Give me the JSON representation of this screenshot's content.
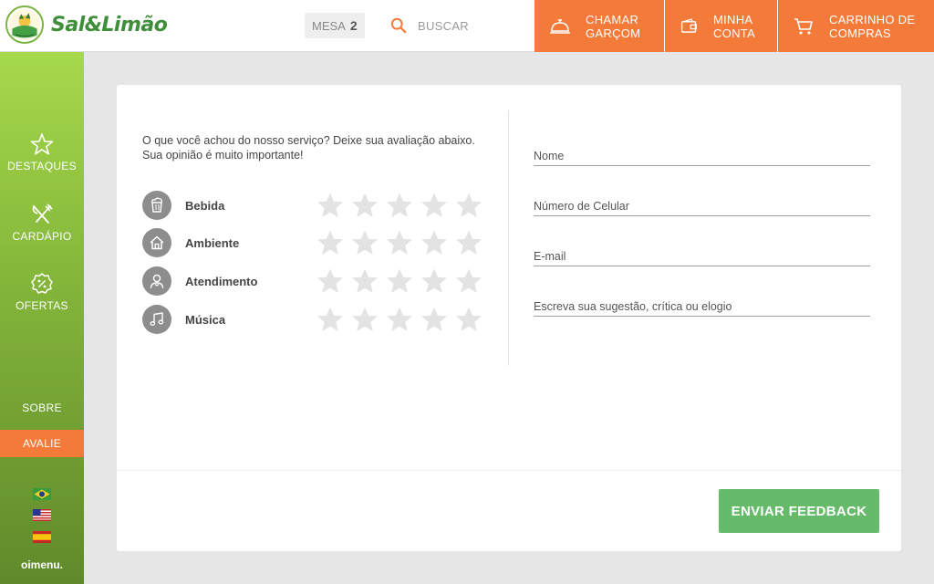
{
  "brand": {
    "name": "Sal&Limão",
    "logo_text": "CUIABANA"
  },
  "header": {
    "table_label": "MESA",
    "table_number": "2",
    "search_label": "BUSCAR",
    "call_waiter": [
      "CHAMAR",
      "GARÇOM"
    ],
    "my_account": [
      "MINHA",
      "CONTA"
    ],
    "cart": [
      "CARRINHO DE",
      "COMPRAS"
    ],
    "accent_color": "#f47a3a"
  },
  "sidebar": {
    "items": [
      {
        "label": "DESTAQUES",
        "icon": "star-icon"
      },
      {
        "label": "CARDÁPIO",
        "icon": "cutlery-icon"
      },
      {
        "label": "OFERTAS",
        "icon": "discount-badge-icon"
      }
    ],
    "about": "SOBRE",
    "rate": "AVALIE",
    "languages": [
      "flag-brazil",
      "flag-usa",
      "flag-spain"
    ],
    "footer_brand": "oimenu."
  },
  "feedback": {
    "intro_line1": "O que você achou do nosso serviço? Deixe sua avaliação abaixo.",
    "intro_line2": "Sua opinião é muito importante!",
    "categories": [
      {
        "label": "Bebida",
        "icon": "drink-icon",
        "stars": 0
      },
      {
        "label": "Ambiente",
        "icon": "house-icon",
        "stars": 0
      },
      {
        "label": "Atendimento",
        "icon": "waiter-icon",
        "stars": 0
      },
      {
        "label": "Música",
        "icon": "music-note-icon",
        "stars": 0
      }
    ],
    "max_stars": 5,
    "fields": {
      "name": "Nome",
      "phone": "Número de Celular",
      "email": "E-mail",
      "message": "Escreva sua sugestão, crítica ou elogio"
    },
    "submit": "ENVIAR FEEDBACK",
    "submit_color": "#66bb6a"
  }
}
